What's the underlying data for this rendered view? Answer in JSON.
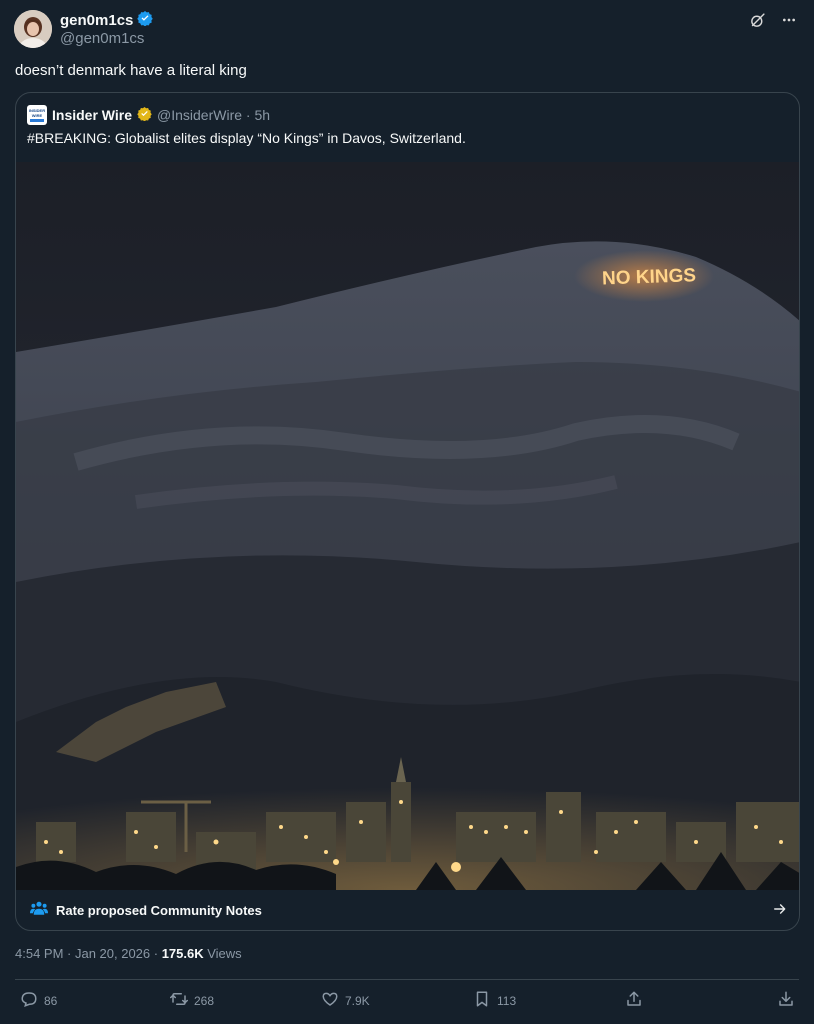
{
  "author": {
    "display_name": "gen0m1cs",
    "handle": "@gen0m1cs",
    "verified_icon": "verified-badge-icon"
  },
  "tweet_text": "doesn’t denmark have a literal king",
  "header_icons": [
    "grok-icon",
    "more-icon"
  ],
  "quote": {
    "logo_text": [
      "INSIDER",
      "WIRE"
    ],
    "display_name": "Insider Wire",
    "verified_icon": "gold-verified-badge-icon",
    "handle_time": "@InsiderWire · 5h",
    "text": "#BREAKING: Globalist elites display “No Kings” in Davos, Switzerland.",
    "image_overlay_text": "NO KINGS",
    "community_notes": {
      "label": "Rate proposed Community Notes",
      "icon": "community-notes-icon",
      "arrow_icon": "arrow-right-icon"
    }
  },
  "meta": {
    "time": "4:54 PM · Jan 20, 2026 · ",
    "views_count": "175.6K",
    "views_label": " Views"
  },
  "actions": {
    "replies": "86",
    "reposts": "268",
    "likes": "7.9K",
    "bookmarks": "113"
  },
  "colors": {
    "background": "#15202b",
    "border": "#38444d",
    "secondary_text": "#8b98a5",
    "accent": "#1d9bf0",
    "gold_badge": "#e2b719",
    "glow": "#ff9a3c"
  }
}
